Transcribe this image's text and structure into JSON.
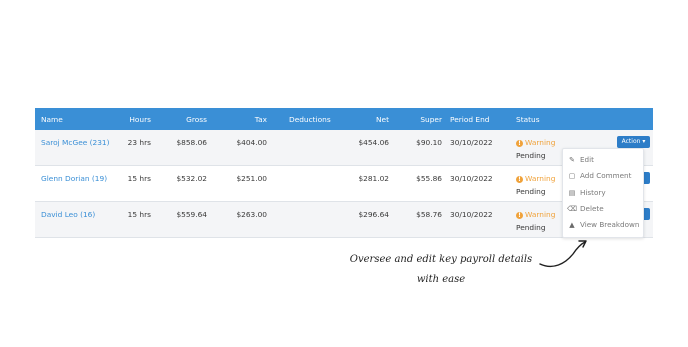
{
  "table": {
    "headers": {
      "name": "Name",
      "hours": "Hours",
      "gross": "Gross",
      "tax": "Tax",
      "deductions": "Deductions",
      "net": "Net",
      "super": "Super",
      "period_end": "Period End",
      "status": "Status"
    },
    "rows": [
      {
        "name": "Saroj McGee (231)",
        "hours": "23 hrs",
        "gross": "$858.06",
        "tax": "$404.00",
        "deductions": "",
        "net": "$454.06",
        "super": "$90.10",
        "period_end": "30/10/2022",
        "status_warning": "Warning",
        "status_state": "Pending"
      },
      {
        "name": "Glenn Dorian (19)",
        "hours": "15 hrs",
        "gross": "$532.02",
        "tax": "$251.00",
        "deductions": "",
        "net": "$281.02",
        "super": "$55.86",
        "period_end": "30/10/2022",
        "status_warning": "Warning",
        "status_state": "Pending"
      },
      {
        "name": "David Leo (16)",
        "hours": "15 hrs",
        "gross": "$559.64",
        "tax": "$263.00",
        "deductions": "",
        "net": "$296.64",
        "super": "$58.76",
        "period_end": "30/10/2022",
        "status_warning": "Warning",
        "status_state": "Pending"
      }
    ]
  },
  "action_button": {
    "label": "Action"
  },
  "action_menu": {
    "items": [
      {
        "label": "Edit",
        "icon": "pencil-icon"
      },
      {
        "label": "Add Comment",
        "icon": "comment-icon"
      },
      {
        "label": "History",
        "icon": "history-icon"
      },
      {
        "label": "Delete",
        "icon": "trash-icon"
      },
      {
        "label": "View Breakdown",
        "icon": "triangle-icon"
      }
    ]
  },
  "caption": {
    "line1": "Oversee and edit key payroll details",
    "line2": "with ease"
  },
  "colors": {
    "header": "#3a8fd6",
    "warning": "#f0a23a",
    "action": "#2d7dc8"
  }
}
